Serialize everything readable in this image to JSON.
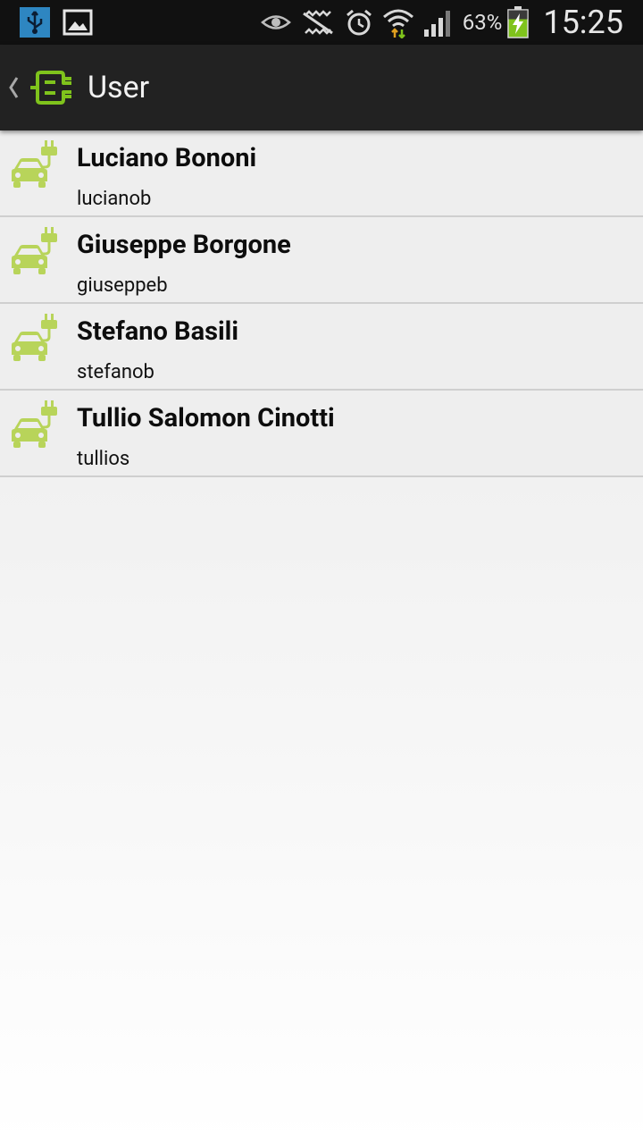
{
  "status_bar": {
    "battery_percent": "63%",
    "time": "15:25",
    "icons": [
      "usb-icon",
      "image-icon",
      "eye-icon",
      "silent-icon",
      "alarm-icon",
      "wifi-icon",
      "signal-icon",
      "battery-icon"
    ]
  },
  "action_bar": {
    "title": "User",
    "logo": "plug-logo-icon",
    "accent_color": "#7fc31c"
  },
  "users": [
    {
      "name": "Luciano Bononi",
      "username": "lucianob"
    },
    {
      "name": "Giuseppe Borgone",
      "username": "giuseppeb"
    },
    {
      "name": "Stefano Basili",
      "username": "stefanob"
    },
    {
      "name": "Tullio Salomon Cinotti",
      "username": "tullios"
    }
  ],
  "colors": {
    "row_icon": "#b8d45a",
    "status_bar_bg": "#111111",
    "action_bar_bg": "#222222"
  }
}
